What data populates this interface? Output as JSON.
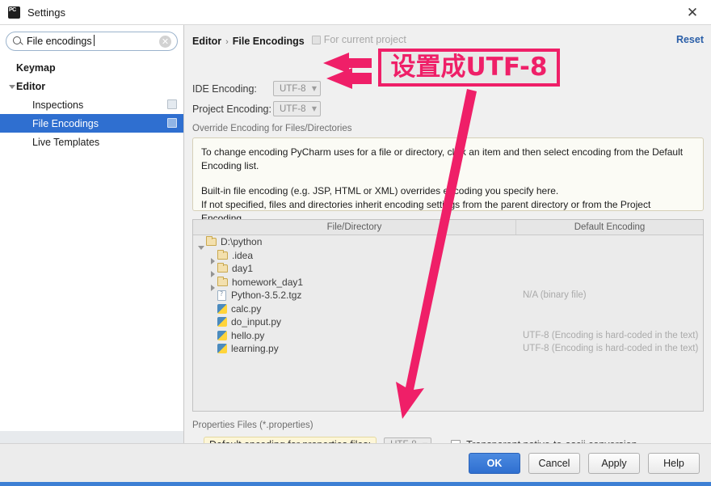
{
  "window": {
    "title": "Settings",
    "app_icon": "pycharm-icon",
    "close_icon": "close-icon"
  },
  "sidebar": {
    "search": {
      "value": "File encodings",
      "placeholder": "Search settings",
      "search_icon": "search-icon",
      "clear_icon": "clear-icon"
    },
    "items": [
      {
        "label": "Keymap",
        "bold": true,
        "indent": 0,
        "twisty": "none",
        "selected": false,
        "scope_icon": false
      },
      {
        "label": "Editor",
        "bold": true,
        "indent": 0,
        "twisty": "down",
        "selected": false,
        "scope_icon": false
      },
      {
        "label": "Inspections",
        "bold": false,
        "indent": 1,
        "twisty": "none",
        "selected": false,
        "scope_icon": true
      },
      {
        "label": "File Encodings",
        "bold": false,
        "indent": 1,
        "twisty": "none",
        "selected": true,
        "scope_icon": true
      },
      {
        "label": "Live Templates",
        "bold": false,
        "indent": 1,
        "twisty": "none",
        "selected": false,
        "scope_icon": false
      }
    ]
  },
  "main": {
    "breadcrumb": {
      "parent": "Editor",
      "separator": "›",
      "current": "File Encodings",
      "note": "For current project",
      "note_icon": "project-scope-icon"
    },
    "reset_label": "Reset",
    "encodings": [
      {
        "label": "IDE Encoding:",
        "value": "UTF-8"
      },
      {
        "label": "Project Encoding:",
        "value": "UTF-8"
      }
    ],
    "override_section_title": "Override Encoding for Files/Directories",
    "info_paragraphs": [
      "To change encoding PyCharm uses for a file or directory, click an item and then select encoding from the Default Encoding list.",
      "Built-in file encoding (e.g. JSP, HTML or XML) overrides encoding you specify here.",
      "If not specified, files and directories inherit encoding settings from the parent directory or from the Project Encoding."
    ],
    "table": {
      "columns": [
        "File/Directory",
        "Default Encoding"
      ],
      "rows": [
        {
          "name": "D:\\python",
          "indent": 0,
          "twisty": "open",
          "icon": "folder-icon",
          "encoding": ""
        },
        {
          "name": ".idea",
          "indent": 1,
          "twisty": "closed",
          "icon": "folder-icon",
          "encoding": ""
        },
        {
          "name": "day1",
          "indent": 1,
          "twisty": "closed",
          "icon": "folder-icon",
          "encoding": ""
        },
        {
          "name": "homework_day1",
          "indent": 1,
          "twisty": "closed",
          "icon": "folder-icon",
          "encoding": ""
        },
        {
          "name": "Python-3.5.2.tgz",
          "indent": 1,
          "twisty": "none",
          "icon": "binary-file-icon",
          "encoding": "N/A (binary file)"
        },
        {
          "name": "calc.py",
          "indent": 1,
          "twisty": "none",
          "icon": "python-file-icon",
          "encoding": ""
        },
        {
          "name": "do_input.py",
          "indent": 1,
          "twisty": "none",
          "icon": "python-file-icon",
          "encoding": ""
        },
        {
          "name": "hello.py",
          "indent": 1,
          "twisty": "none",
          "icon": "python-file-icon",
          "encoding": "UTF-8 (Encoding is hard-coded in the text)"
        },
        {
          "name": "learning.py",
          "indent": 1,
          "twisty": "none",
          "icon": "python-file-icon",
          "encoding": "UTF-8 (Encoding is hard-coded in the text)"
        }
      ]
    },
    "properties": {
      "section_title": "Properties Files (*.properties)",
      "default_encoding_label": "Default encoding for properties files:",
      "default_encoding_value": "UTF-8",
      "transparent_label": "Transparent native-to-ascii conversion",
      "transparent_checked": false
    }
  },
  "footer": {
    "buttons": [
      {
        "label": "OK",
        "primary": true
      },
      {
        "label": "Cancel",
        "primary": false
      },
      {
        "label": "Apply",
        "primary": false
      },
      {
        "label": "Help",
        "primary": false
      }
    ]
  },
  "annotation": {
    "text": "设置成UTF-8",
    "color": "#ef1f68",
    "arrows": [
      "double-left-arrow-to-encodings",
      "long-down-arrow-to-properties-encoding"
    ]
  }
}
